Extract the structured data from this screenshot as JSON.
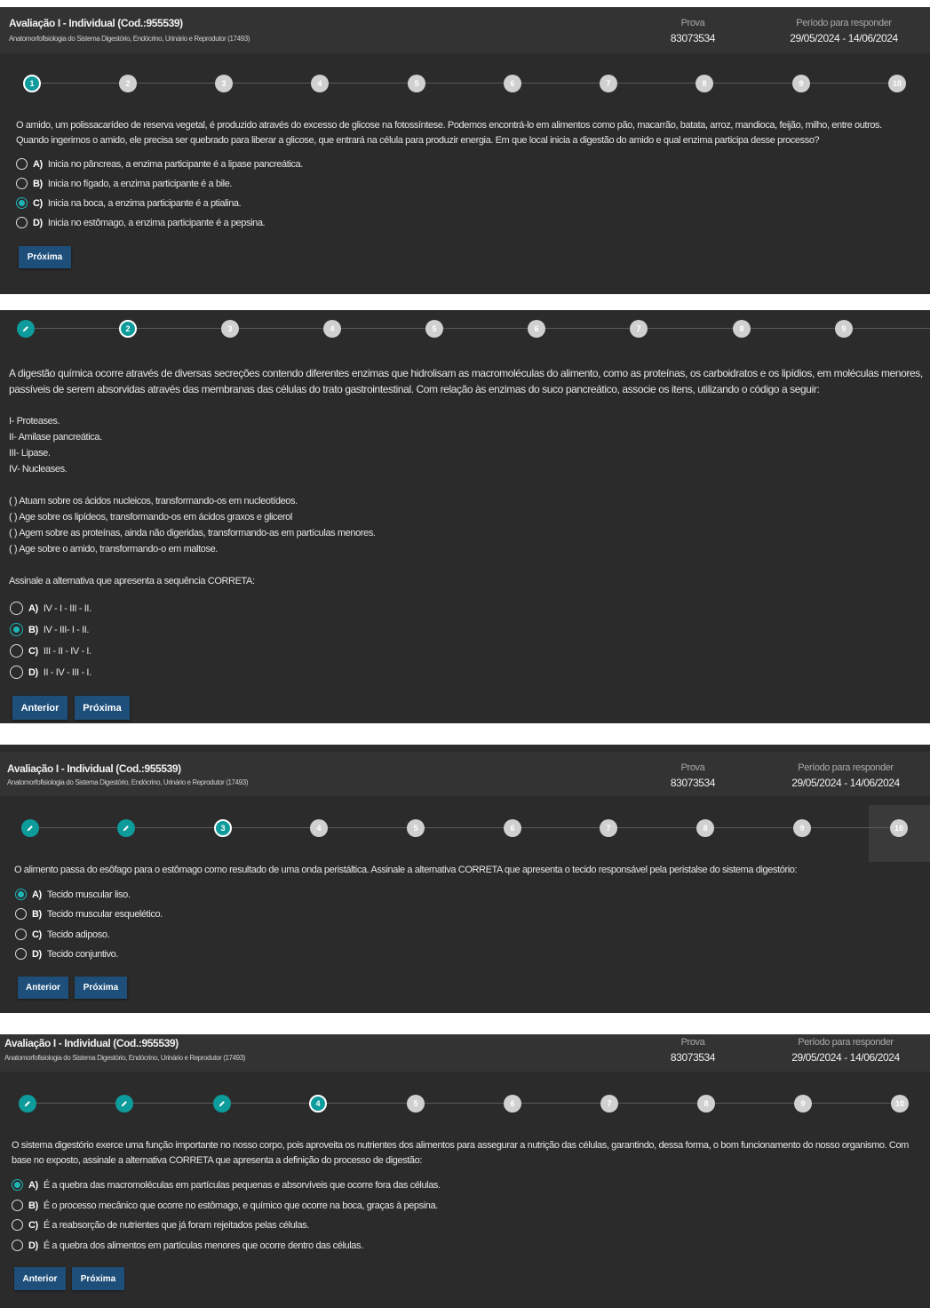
{
  "header": {
    "title": "Avaliação I - Individual (Cod.:955539)",
    "subtitle": "Anatomorfofisiologia do Sistema Digestório, Endócrino, Urinário e Reprodutor (17493)",
    "prova_label": "Prova",
    "prova_value": "83073534",
    "periodo_label": "Período para responder",
    "periodo_value": "29/05/2024 - 14/06/2024"
  },
  "steps": [
    "1",
    "2",
    "3",
    "4",
    "5",
    "6",
    "7",
    "8",
    "9",
    "10"
  ],
  "buttons": {
    "next": "Próxima",
    "prev": "Anterior"
  },
  "q1": {
    "text": "O amido, um polissacarídeo de reserva vegetal, é produzido através do excesso de glicose na fotossíntese. Podemos encontrá-lo em alimentos como pão, macarrão, batata, arroz, mandioca, feijão, milho, entre outros. Quando ingerimos o amido, ele precisa ser quebrado para liberar a glicose, que entrará na célula para produzir energia. Em que local inicia a digestão do amido e qual enzima participa desse processo?",
    "options": [
      {
        "letter": "A)",
        "text": "Inicia no pâncreas, a enzima participante é a lipase pancreática."
      },
      {
        "letter": "B)",
        "text": "Inicia no fígado, a enzima participante é a bile."
      },
      {
        "letter": "C)",
        "text": "Inicia na boca, a enzima participante é a ptialina."
      },
      {
        "letter": "D)",
        "text": "Inicia no estômago, a enzima participante é a pepsina."
      }
    ],
    "selected": "C"
  },
  "q2": {
    "text": "A digestão química ocorre através de diversas secreções contendo diferentes enzimas que hidrolisam as macromoléculas do alimento, como as proteínas, os carboidratos e os lipídios, em moléculas menores, passíveis de serem absorvidas através das membranas das células do trato gastrointestinal. Com relação às enzimas do suco pancreático, associe os itens, utilizando o código a seguir:",
    "items": [
      "I- Proteases.",
      "II- Amilase pancreática.",
      "III- Lipase.",
      "IV- Nucleases."
    ],
    "statements": [
      "(   ) Atuam sobre os ácidos nucleicos, transformando-os em nucleotídeos.",
      "(   ) Age sobre os lipídeos, transformando-os em ácidos graxos e glicerol",
      "(   ) Agem sobre as proteínas, ainda não digeridas, transformando-as em partículas menores.",
      "(   ) Age sobre o amido, transformando-o em maltose."
    ],
    "prompt": "Assinale a alternativa que apresenta a sequência CORRETA:",
    "options": [
      {
        "letter": "A)",
        "text": "IV - I - III - II."
      },
      {
        "letter": "B)",
        "text": "IV - III- I - II."
      },
      {
        "letter": "C)",
        "text": "III - II - IV - I."
      },
      {
        "letter": "D)",
        "text": "II - IV - III - I."
      }
    ],
    "selected": "B"
  },
  "q3": {
    "text": "O alimento passa do esôfago para o estômago como resultado de uma onda peristáltica. Assinale a alternativa CORRETA que apresenta o tecido responsável pela peristalse do sistema digestório:",
    "options": [
      {
        "letter": "A)",
        "text": "Tecido muscular liso."
      },
      {
        "letter": "B)",
        "text": "Tecido muscular esquelético."
      },
      {
        "letter": "C)",
        "text": "Tecido adiposo."
      },
      {
        "letter": "D)",
        "text": "Tecido conjuntivo."
      }
    ],
    "selected": "A"
  },
  "q4": {
    "text": "O sistema digestório exerce uma função importante no nosso corpo, pois aproveita os nutrientes dos alimentos para assegurar a nutrição das células, garantindo, dessa forma, o bom funcionamento do nosso organismo. Com base no exposto, assinale a alternativa CORRETA que apresenta a definição do processo de digestão:",
    "options": [
      {
        "letter": "A)",
        "text": "É a quebra das macromoléculas em partículas pequenas e absorvíveis que ocorre fora das células."
      },
      {
        "letter": "B)",
        "text": "É o processo mecânico que ocorre no estômago, e químico que ocorre na boca, graças à pepsina."
      },
      {
        "letter": "C)",
        "text": "É a reabsorção de nutrientes que já foram rejeitados pelas células."
      },
      {
        "letter": "D)",
        "text": "É a quebra dos alimentos em partículas menores que ocorre dentro das células."
      }
    ],
    "selected": "A"
  }
}
